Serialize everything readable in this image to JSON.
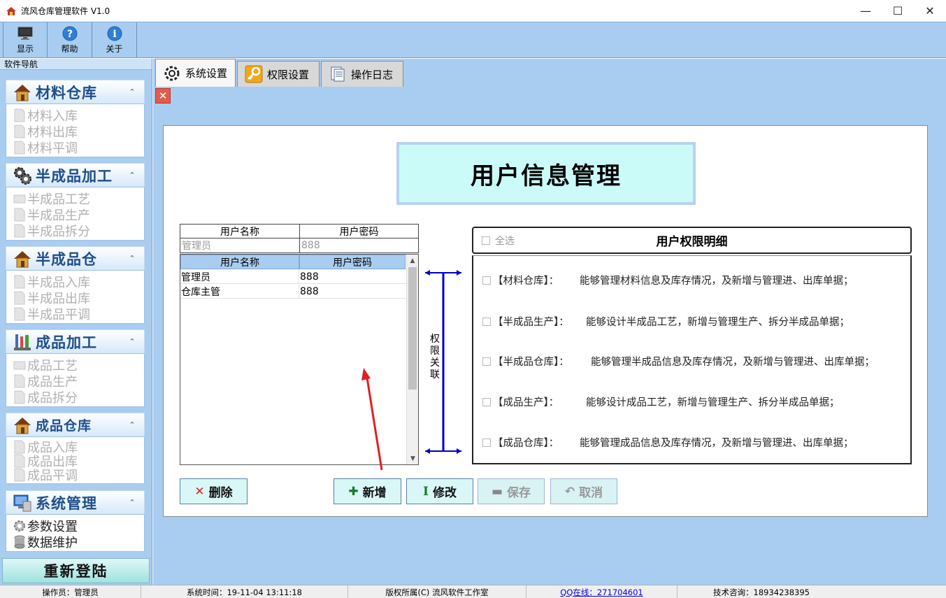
{
  "window": {
    "title": "流风仓库管理软件 V1.0",
    "minimize": "—",
    "maximize": "☐",
    "close": "✕"
  },
  "toolbar": {
    "items": [
      {
        "label": "显示",
        "icon": "monitor-icon"
      },
      {
        "label": "帮助",
        "icon": "help-icon"
      },
      {
        "label": "关于",
        "icon": "info-icon"
      }
    ]
  },
  "sidebar": {
    "title": "软件导航",
    "groups": [
      {
        "label": "材料仓库",
        "icon": "house-icon",
        "items": [
          "材料入库",
          "材料出库",
          "材料平调"
        ]
      },
      {
        "label": "半成品加工",
        "icon": "gears-icon",
        "items": [
          "半成品工艺",
          "半成品生产",
          "半成品拆分"
        ]
      },
      {
        "label": "半成品仓",
        "icon": "house-icon",
        "items": [
          "半成品入库",
          "半成品出库",
          "半成品平调"
        ]
      },
      {
        "label": "成品加工",
        "icon": "tools-icon",
        "items": [
          "成品工艺",
          "成品生产",
          "成品拆分"
        ]
      },
      {
        "label": "成品仓库",
        "icon": "house-icon",
        "items": [
          "成品入库",
          "成品出库",
          "成品平调"
        ]
      },
      {
        "label": "系统管理",
        "icon": "computer-icon",
        "items": [
          "参数设置",
          "数据维护"
        ]
      }
    ],
    "relogin": "重新登陆"
  },
  "tabs": [
    {
      "label": "系统设置",
      "icon": "gear-icon"
    },
    {
      "label": "权限设置",
      "icon": "key-icon"
    },
    {
      "label": "操作日志",
      "icon": "log-icon"
    }
  ],
  "content": {
    "heading": "用户信息管理",
    "input": {
      "col1": "用户名称",
      "col2": "用户密码",
      "name_value": "管理员",
      "password_value": "888"
    },
    "grid": {
      "col1": "用户名称",
      "col2": "用户密码",
      "rows": [
        {
          "name": "管理员",
          "password": "888"
        },
        {
          "name": "仓库主管",
          "password": "888"
        }
      ]
    },
    "relation_label": "权限关联",
    "permissions": {
      "select_all": "全选",
      "title": "用户权限明细",
      "rows": [
        {
          "name": "【材料仓库】：",
          "desc": "能够管理材料信息及库存情况，及新增与管理进、出库单据；"
        },
        {
          "name": "【半成品生产】：",
          "desc": "能够设计半成品工艺，新增与管理生产、拆分半成品单据；"
        },
        {
          "name": "【半成品仓库】：",
          "desc": "能够管理半成品信息及库存情况，及新增与管理进、出库单据；"
        },
        {
          "name": "【成品生产】：",
          "desc": "能够设计成品工艺，新增与管理生产、拆分半成品单据；"
        },
        {
          "name": "【成品仓库】：",
          "desc": "能够管理成品信息及库存情况，及新增与管理进、出库单据；"
        }
      ]
    },
    "buttons": {
      "delete": "删除",
      "add": "新增",
      "edit": "修改",
      "save": "保存",
      "cancel": "取消"
    }
  },
  "statusbar": {
    "operator": "操作员：管理员",
    "time": "系统时间：19-11-04 13:11:18",
    "copyright": "版权所属(C) 流风软件工作室",
    "qq": "QQ在线：271704601",
    "support": "技术咨询：18934238395"
  },
  "colors": {
    "chrome_blue": "#a9cdf1",
    "heading_bg": "#cbfbf8",
    "button_bg": "#d9f7f6",
    "relation_blue": "#0000cc",
    "annotation_red": "#e02020"
  }
}
